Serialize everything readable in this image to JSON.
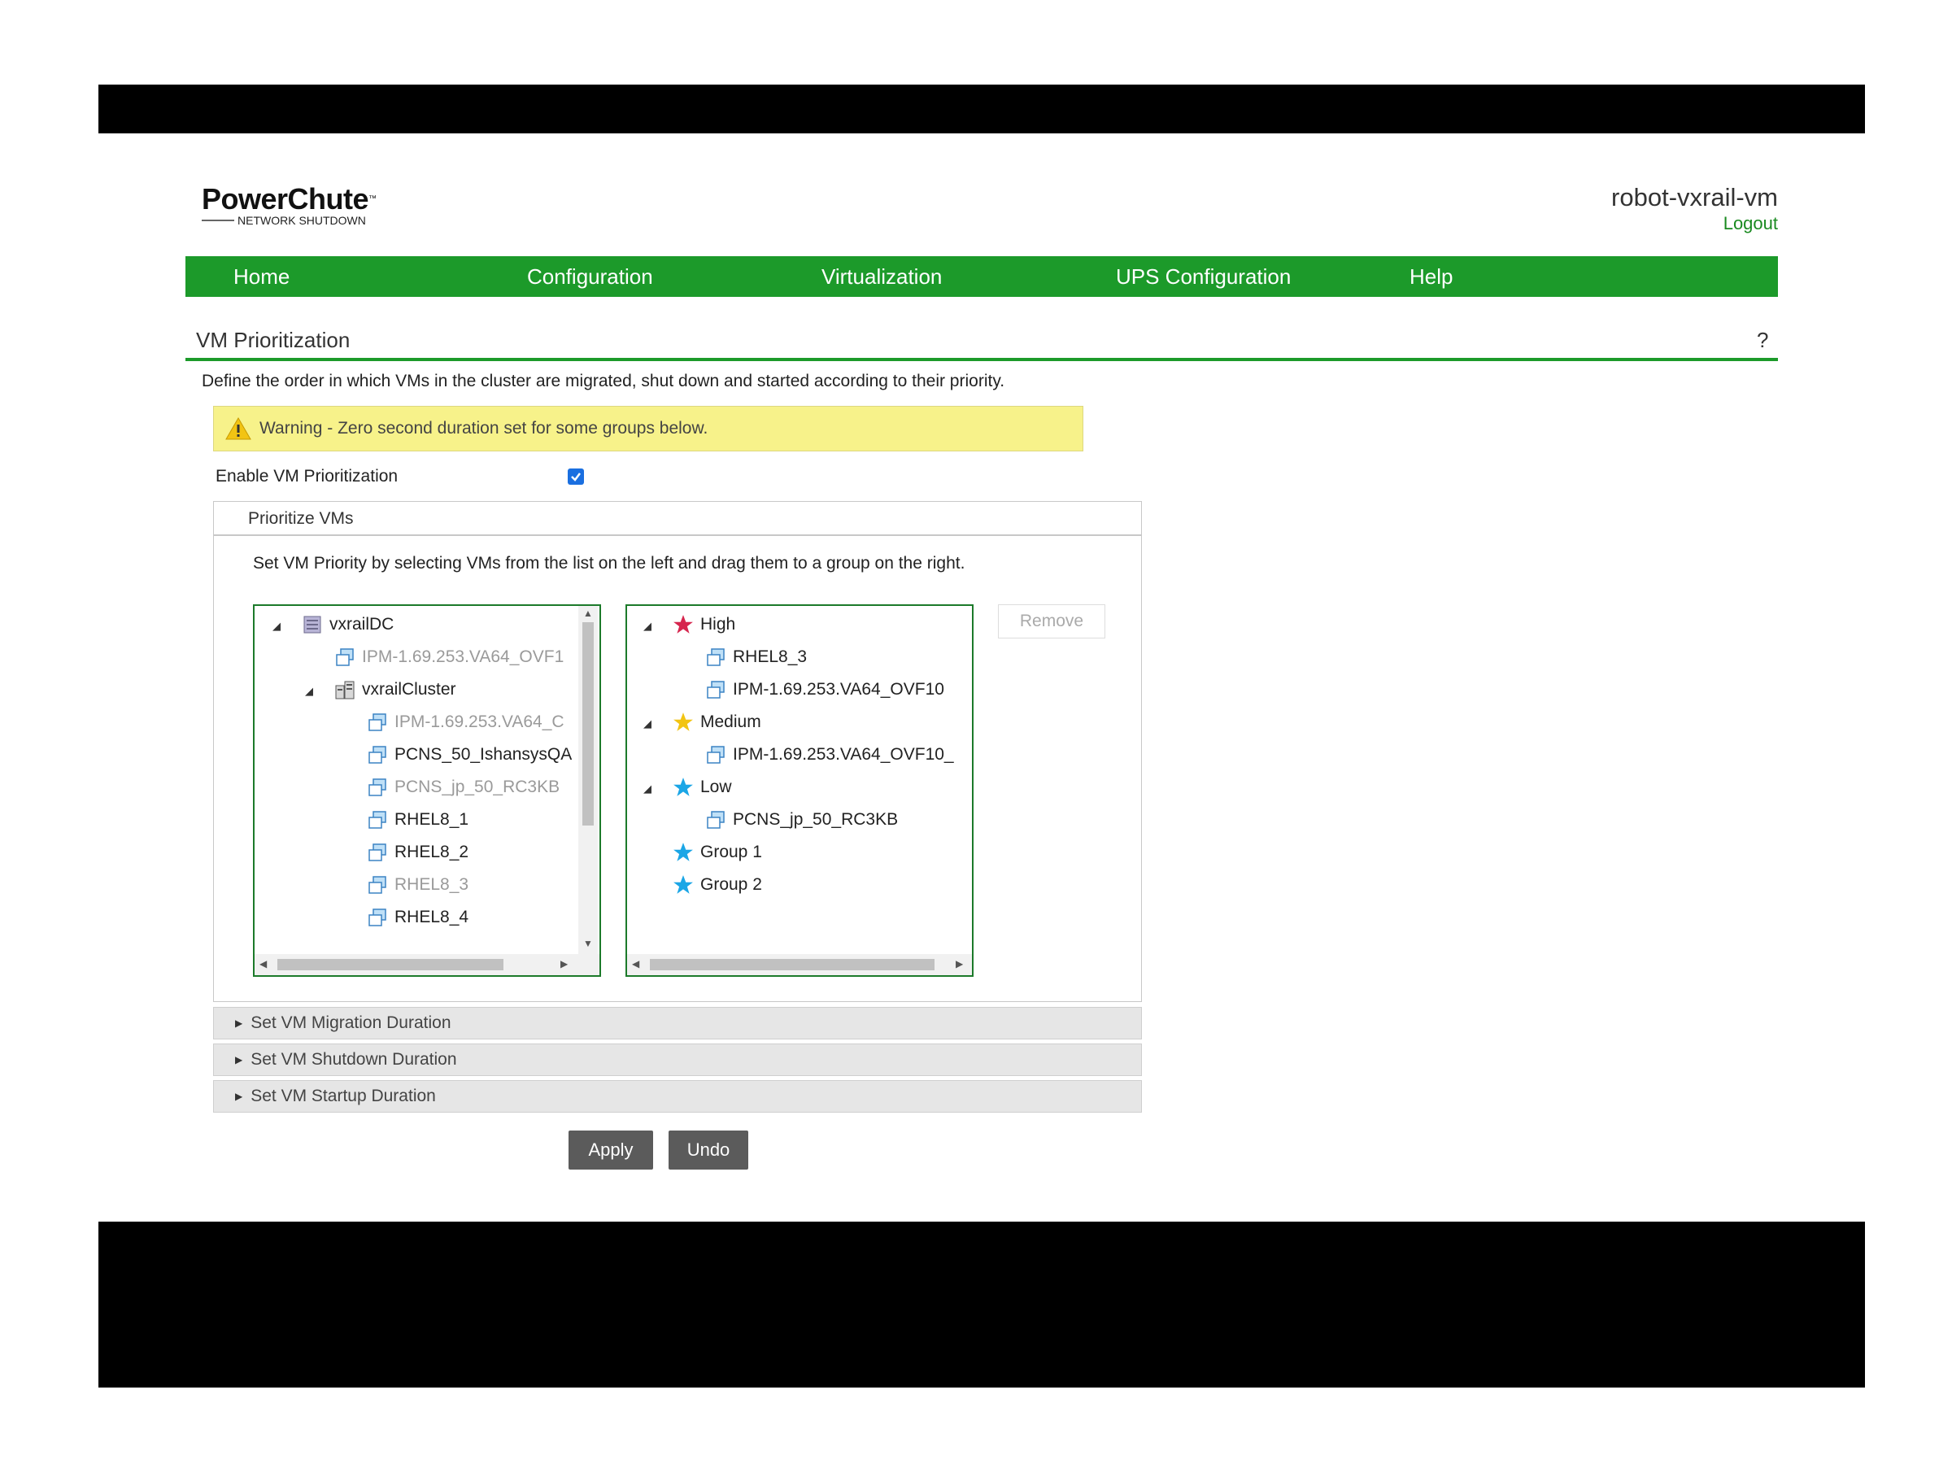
{
  "header": {
    "logo_name": "PowerChute",
    "logo_tm": "™",
    "logo_sub": "NETWORK SHUTDOWN",
    "hostname": "robot-vxrail-vm",
    "logout": "Logout"
  },
  "nav": {
    "items": [
      "Home",
      "Configuration",
      "Virtualization",
      "UPS Configuration",
      "Help"
    ]
  },
  "page": {
    "title": "VM Prioritization",
    "help": "?",
    "description": "Define the order in which VMs in the cluster are migrated, shut down and started according to their priority.",
    "warning": "Warning - Zero second duration set for some groups below.",
    "enable_label": "Enable VM Prioritization",
    "enable_checked": true
  },
  "panel": {
    "title": "Prioritize VMs",
    "instructions": "Set VM Priority by selecting VMs from the list on the left and drag them to a group on the right.",
    "remove_label": "Remove",
    "left_tree": [
      {
        "label": "vxrailDC",
        "type": "datacenter",
        "expanded": true,
        "dim": false
      },
      {
        "label": "IPM-1.69.253.VA64_OVF1",
        "type": "vm",
        "dim": true
      },
      {
        "label": "vxrailCluster",
        "type": "cluster",
        "expanded": true,
        "dim": false
      },
      {
        "label": "IPM-1.69.253.VA64_C",
        "type": "vm",
        "dim": true
      },
      {
        "label": "PCNS_50_IshansysQA",
        "type": "vm",
        "dim": false
      },
      {
        "label": "PCNS_jp_50_RC3KB",
        "type": "vm",
        "dim": true
      },
      {
        "label": "RHEL8_1",
        "type": "vm",
        "dim": false
      },
      {
        "label": "RHEL8_2",
        "type": "vm",
        "dim": false
      },
      {
        "label": "RHEL8_3",
        "type": "vm",
        "dim": true
      },
      {
        "label": "RHEL8_4",
        "type": "vm",
        "dim": false
      }
    ],
    "right_tree": [
      {
        "label": "High",
        "type": "group",
        "star_color": "#d6264e"
      },
      {
        "label": "RHEL8_3",
        "type": "vm"
      },
      {
        "label": "IPM-1.69.253.VA64_OVF10",
        "type": "vm"
      },
      {
        "label": "Medium",
        "type": "group",
        "star_color": "#f2c413"
      },
      {
        "label": "IPM-1.69.253.VA64_OVF10_",
        "type": "vm"
      },
      {
        "label": "Low",
        "type": "group",
        "star_color": "#1ba6e6"
      },
      {
        "label": "PCNS_jp_50_RC3KB",
        "type": "vm"
      },
      {
        "label": "Group 1",
        "type": "group",
        "star_color": "#1ba6e6"
      },
      {
        "label": "Group 2",
        "type": "group",
        "star_color": "#1ba6e6"
      }
    ]
  },
  "accordions": [
    "Set VM Migration Duration",
    "Set VM Shutdown Duration",
    "Set VM Startup Duration"
  ],
  "buttons": {
    "apply": "Apply",
    "undo": "Undo"
  },
  "colors": {
    "brand_green": "#1c9a2a",
    "warning_bg": "#f7f28a",
    "button_gray": "#5b5b5b"
  }
}
